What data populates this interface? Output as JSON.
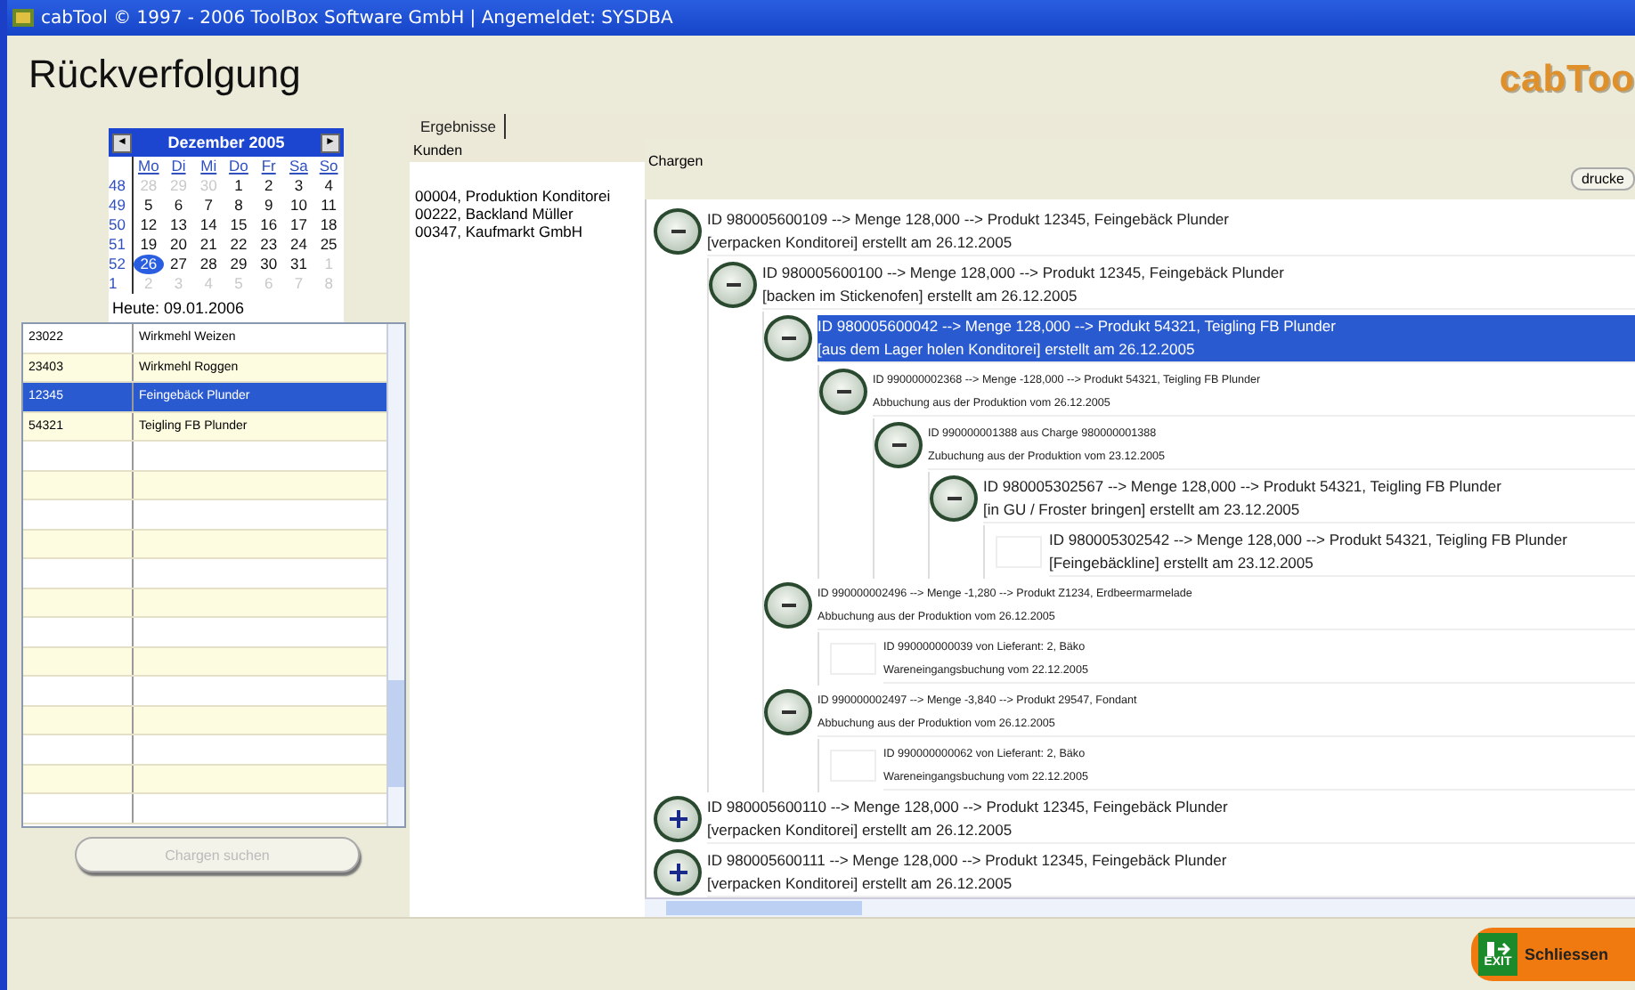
{
  "window": {
    "title": "cabTool © 1997 - 2006 ToolBox Software GmbH | Angemeldet: SYSDBA"
  },
  "header": {
    "title": "Rückverfolgung",
    "logo": "cabToo"
  },
  "calendar": {
    "month": "Dezember 2005",
    "prev": "◄",
    "next": "►",
    "weekdays": [
      "Mo",
      "Di",
      "Mi",
      "Do",
      "Fr",
      "Sa",
      "So"
    ],
    "weeks": [
      {
        "number": "48",
        "days": [
          {
            "day": "28",
            "other_month": true,
            "selected": false
          },
          {
            "day": "29",
            "other_month": true,
            "selected": false
          },
          {
            "day": "30",
            "other_month": true,
            "selected": false
          },
          {
            "day": "1",
            "other_month": false,
            "selected": false
          },
          {
            "day": "2",
            "other_month": false,
            "selected": false
          },
          {
            "day": "3",
            "other_month": false,
            "selected": false
          },
          {
            "day": "4",
            "other_month": false,
            "selected": false
          }
        ]
      },
      {
        "number": "49",
        "days": [
          {
            "day": "5",
            "other_month": false,
            "selected": false
          },
          {
            "day": "6",
            "other_month": false,
            "selected": false
          },
          {
            "day": "7",
            "other_month": false,
            "selected": false
          },
          {
            "day": "8",
            "other_month": false,
            "selected": false
          },
          {
            "day": "9",
            "other_month": false,
            "selected": false
          },
          {
            "day": "10",
            "other_month": false,
            "selected": false
          },
          {
            "day": "11",
            "other_month": false,
            "selected": false
          }
        ]
      },
      {
        "number": "50",
        "days": [
          {
            "day": "12",
            "other_month": false,
            "selected": false
          },
          {
            "day": "13",
            "other_month": false,
            "selected": false
          },
          {
            "day": "14",
            "other_month": false,
            "selected": false
          },
          {
            "day": "15",
            "other_month": false,
            "selected": false
          },
          {
            "day": "16",
            "other_month": false,
            "selected": false
          },
          {
            "day": "17",
            "other_month": false,
            "selected": false
          },
          {
            "day": "18",
            "other_month": false,
            "selected": false
          }
        ]
      },
      {
        "number": "51",
        "days": [
          {
            "day": "19",
            "other_month": false,
            "selected": false
          },
          {
            "day": "20",
            "other_month": false,
            "selected": false
          },
          {
            "day": "21",
            "other_month": false,
            "selected": false
          },
          {
            "day": "22",
            "other_month": false,
            "selected": false
          },
          {
            "day": "23",
            "other_month": false,
            "selected": false
          },
          {
            "day": "24",
            "other_month": false,
            "selected": false
          },
          {
            "day": "25",
            "other_month": false,
            "selected": false
          }
        ]
      },
      {
        "number": "52",
        "days": [
          {
            "day": "26",
            "other_month": false,
            "selected": true
          },
          {
            "day": "27",
            "other_month": false,
            "selected": false
          },
          {
            "day": "28",
            "other_month": false,
            "selected": false
          },
          {
            "day": "29",
            "other_month": false,
            "selected": false
          },
          {
            "day": "30",
            "other_month": false,
            "selected": false
          },
          {
            "day": "31",
            "other_month": false,
            "selected": false
          },
          {
            "day": "1",
            "other_month": true,
            "selected": false
          }
        ]
      },
      {
        "number": "1",
        "days": [
          {
            "day": "2",
            "other_month": true,
            "selected": false
          },
          {
            "day": "3",
            "other_month": true,
            "selected": false
          },
          {
            "day": "4",
            "other_month": true,
            "selected": false
          },
          {
            "day": "5",
            "other_month": true,
            "selected": false
          },
          {
            "day": "6",
            "other_month": true,
            "selected": false
          },
          {
            "day": "7",
            "other_month": true,
            "selected": false
          },
          {
            "day": "8",
            "other_month": true,
            "selected": false
          }
        ]
      }
    ],
    "today": "Heute: 09.01.2006"
  },
  "products": [
    {
      "code": "23022",
      "name": "Wirkmehl Weizen",
      "selected": false
    },
    {
      "code": "23403",
      "name": "Wirkmehl Roggen",
      "selected": false
    },
    {
      "code": "12345",
      "name": "Feingebäck Plunder",
      "selected": true
    },
    {
      "code": "54321",
      "name": "Teigling FB Plunder",
      "selected": false
    }
  ],
  "search_button": {
    "label": "Chargen suchen",
    "disabled": true
  },
  "tabs": [
    {
      "label": "Ergebnisse",
      "selected": true
    }
  ],
  "customers": {
    "heading": "Kunden",
    "items": [
      "00004, Produktion Konditorei",
      "00222, Backland Müller",
      "00347, Kaufmarkt GmbH"
    ]
  },
  "batches": {
    "heading": "Chargen",
    "print_button": "drucke",
    "tree": [
      {
        "kind": "batch",
        "line1": "ID 980005600109 --> Menge 128,000 --> Produkt 12345, Feingebäck Plunder",
        "line2": "[verpacken Konditorei] erstellt am 26.12.2005",
        "expanded": true,
        "selected": false,
        "children": [
          {
            "kind": "batch",
            "line1": "ID 980005600100 --> Menge 128,000 --> Produkt 12345, Feingebäck Plunder",
            "line2": "[backen im Stickenofen] erstellt am 26.12.2005",
            "expanded": true,
            "selected": false,
            "children": [
              {
                "kind": "batch",
                "line1": "ID 980005600042 --> Menge 128,000 --> Produkt 54321, Teigling FB Plunder",
                "line2": "[aus dem Lager holen Konditorei] erstellt am 26.12.2005",
                "expanded": true,
                "selected": true,
                "children": [
                  {
                    "kind": "booking",
                    "line1": "ID 990000002368 --> Menge -128,000 --> Produkt 54321, Teigling FB Plunder",
                    "line2": "Abbuchung aus der Produktion vom 26.12.2005",
                    "expanded": true,
                    "selected": false,
                    "children": [
                      {
                        "kind": "booking",
                        "line1": "ID 990000001388 aus Charge 980000001388",
                        "line2": "Zubuchung aus der Produktion vom 23.12.2005",
                        "expanded": true,
                        "selected": false,
                        "children": [
                          {
                            "kind": "batch",
                            "line1": "ID 980005302567 --> Menge 128,000 --> Produkt 54321, Teigling FB Plunder",
                            "line2": "[in GU / Froster bringen] erstellt am 23.12.2005",
                            "expanded": true,
                            "selected": false,
                            "children": [
                              {
                                "kind": "batch",
                                "line1": "ID 980005302542 --> Menge 128,000 --> Produkt 54321, Teigling FB Plunder",
                                "line2": "[Feingebäckline] erstellt am 23.12.2005",
                                "selected": false
                              }
                            ]
                          }
                        ]
                      }
                    ]
                  }
                ]
              },
              {
                "kind": "booking",
                "line1": "ID 990000002496 --> Menge -1,280 --> Produkt Z1234, Erdbeermarmelade",
                "line2": "Abbuchung aus der Produktion vom 26.12.2005",
                "expanded": true,
                "selected": false,
                "children": [
                  {
                    "kind": "booking",
                    "line1": "ID 990000000039 von Lieferant: 2, Bäko",
                    "line2": "Wareneingangsbuchung vom 22.12.2005",
                    "selected": false
                  }
                ]
              },
              {
                "kind": "booking",
                "line1": "ID 990000002497 --> Menge -3,840 --> Produkt 29547, Fondant",
                "line2": "Abbuchung aus der Produktion vom 26.12.2005",
                "expanded": true,
                "selected": false,
                "children": [
                  {
                    "kind": "booking",
                    "line1": "ID 990000000062 von Lieferant: 2, Bäko",
                    "line2": "Wareneingangsbuchung vom 22.12.2005",
                    "selected": false
                  }
                ]
              }
            ]
          }
        ]
      },
      {
        "kind": "batch",
        "line1": "ID 980005600110 --> Menge 128,000 --> Produkt 12345, Feingebäck Plunder",
        "line2": "[verpacken Konditorei] erstellt am 26.12.2005",
        "expanded": false,
        "selected": false
      },
      {
        "kind": "batch",
        "line1": "ID 980005600111 --> Menge 128,000 --> Produkt 12345, Feingebäck Plunder",
        "line2": "[verpacken Konditorei] erstellt am 26.12.2005",
        "expanded": false,
        "selected": false
      }
    ]
  },
  "close_button": {
    "icon_text": "EXIT",
    "label": "Schliessen"
  }
}
